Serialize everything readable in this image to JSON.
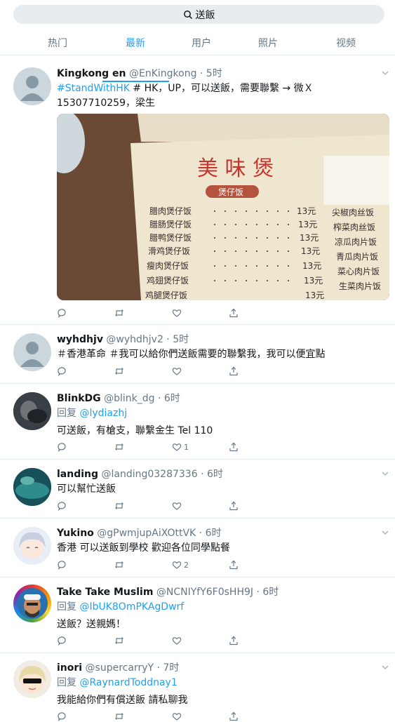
{
  "search": {
    "query": "送飯"
  },
  "tabs": [
    "热门",
    "最新",
    "用户",
    "照片",
    "视频"
  ],
  "tweets": [
    {
      "name": "Kingkong en",
      "handle": "@EnKingkong",
      "time": " · 5时",
      "hashtag": "#StandWithHK",
      "text1": " # HK，UP，可以送飯，需要聯繫 → 微Ｘ",
      "text2": "15307710259，梁生"
    },
    {
      "name": "wyhdhjv",
      "handle": "@wyhdhjv2",
      "time": " · 5时",
      "text1": "＃香港革命 ＃我可以給你們送飯需要的聯繫我，我可以便宜點"
    },
    {
      "name": "BlinkDG",
      "handle": "@blink_dg",
      "time": " · 6时",
      "reply_label": "回复 ",
      "reply_to": "@lydiazhj",
      "text1": "可送飯，有槍支，聯繫金生  Tel 110",
      "likes": "1"
    },
    {
      "name": "landing",
      "handle": "@landing03287336",
      "time": " · 6时",
      "text1": "可以幫忙送飯"
    },
    {
      "name": "Yukino",
      "handle": "@gPwmjupAiXOttVK",
      "time": " · 6时",
      "text1": "香港 可以送飯到學校  歡迎各位同學點餐",
      "likes": "2"
    },
    {
      "name": "Take Take Muslim",
      "handle": "@NCNIYfY6F0sHH9J",
      "time": " · 6时",
      "reply_label": "回复 ",
      "reply_to": "@IbUK8OmPKAgDwrf",
      "text1": "送飯？送親媽！"
    },
    {
      "name": "inori",
      "handle": "@supercarryY",
      "time": " · 7时",
      "reply_label": "回复 ",
      "reply_to": "@RaynardToddnay1",
      "text1": "我能給你們有償送飯 請私聊我"
    }
  ],
  "photo": {
    "title": "美 味 煲",
    "subtitle": "煲仔饭",
    "items": [
      {
        "name": "腊肉煲仔饭",
        "price": "13元"
      },
      {
        "name": "腊肠煲仔饭",
        "price": "13元"
      },
      {
        "name": "腊鸭煲仔饭",
        "price": "13元"
      },
      {
        "name": "滑鸡煲仔饭",
        "price": "13元"
      },
      {
        "name": "瘦肉煲仔饭",
        "price": "13元"
      },
      {
        "name": "鸡翅煲仔饭",
        "price": "13元"
      },
      {
        "name": "鸡腿煲仔饭",
        "price": "13元"
      }
    ],
    "right_items": [
      "尖椒肉丝饭",
      "榨菜肉丝饭",
      "凉瓜肉片饭",
      "青瓜肉片饭",
      "菜心肉片饭",
      "生菜肉片饭"
    ]
  },
  "colors": {
    "accent": "#1da1f2",
    "muted": "#657786"
  }
}
